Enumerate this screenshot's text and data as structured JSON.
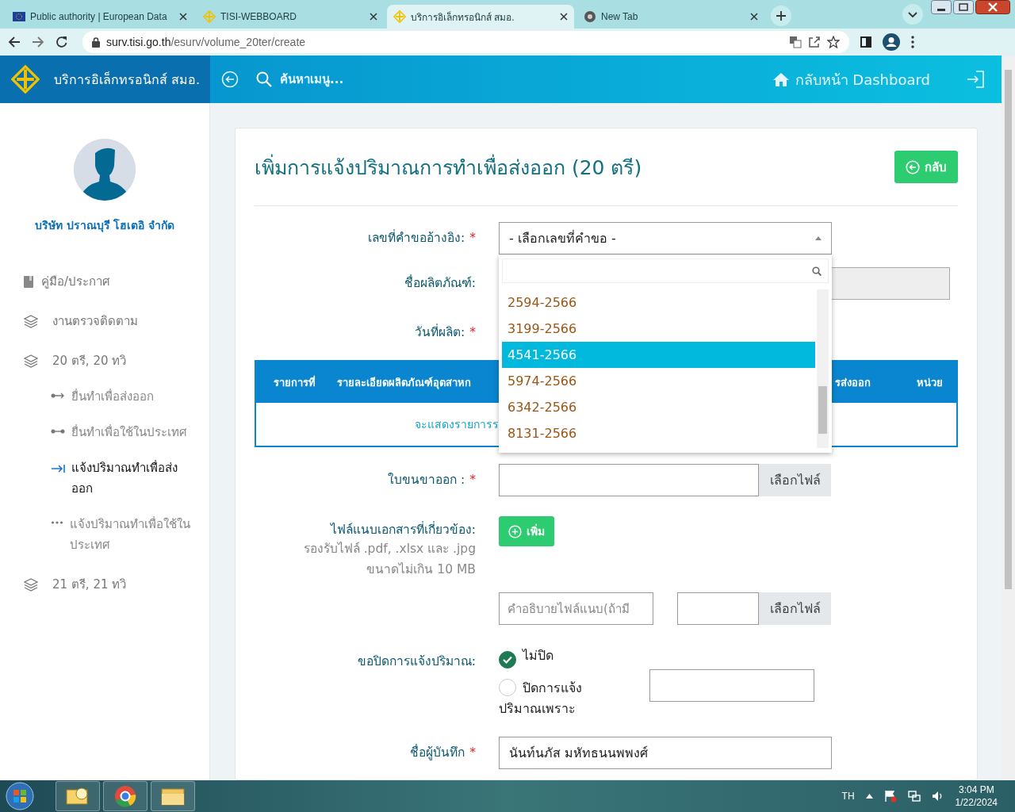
{
  "browser": {
    "tabs": [
      {
        "title": "Public authority | European Data",
        "selected": false
      },
      {
        "title": "TISI-WEBBOARD",
        "selected": false
      },
      {
        "title": "บริการอิเล็กทรอนิกส์ สมอ.",
        "selected": true
      },
      {
        "title": "New Tab",
        "selected": false
      }
    ],
    "url": {
      "host": "surv.tisi.go.th",
      "path": "/esurv/volume_20ter/create"
    }
  },
  "header": {
    "brand": "บริการอิเล็กทรอนิกส์ สมอ.",
    "search_label": "ค้นหาเมนู...",
    "dashboard_link": "กลับหน้า Dashboard"
  },
  "sidebar": {
    "company": "บริษัท ปราณบุรี โฮเตอิ จำกัด",
    "items": [
      {
        "label": "คู่มือ/ประกาศ",
        "kind": "book",
        "selected": false
      },
      {
        "label": "งานตรวจติดตาม",
        "kind": "layers",
        "selected": false
      },
      {
        "label": "20 ตรี, 20 ทวิ",
        "kind": "layers",
        "selected": false,
        "children": [
          {
            "label": "ยื่นทำเพื่อส่งออก",
            "kind": "dot-arrow",
            "selected": false
          },
          {
            "label": "ยื่นทำเพื่อใช้ในประเทศ",
            "kind": "dot-line",
            "selected": false
          },
          {
            "label": "แจ้งปริมาณทำเพื่อส่งออก",
            "kind": "arrow-bar",
            "selected": true
          },
          {
            "label": "แจ้งปริมาณทำเพื่อใช้ในประเทศ",
            "kind": "dots",
            "selected": false
          }
        ]
      },
      {
        "label": "21 ตรี, 21 ทวิ",
        "kind": "layers",
        "selected": false
      }
    ]
  },
  "form": {
    "title": "เพิ่มการแจ้งปริมาณการทำเพื่อส่งออก (20 ตรี)",
    "back_button": "กลับ",
    "reference": {
      "label": "เลขที่คำขออ้างอิง:",
      "required_mark": "*",
      "value": "- เลือกเลขที่คำขอ -",
      "expanded": true,
      "options": [
        {
          "label": "2594-2566",
          "selected": false
        },
        {
          "label": "3199-2566",
          "selected": false
        },
        {
          "label": "4541-2566",
          "selected": true
        },
        {
          "label": "5974-2566",
          "selected": false
        },
        {
          "label": "6342-2566",
          "selected": false
        },
        {
          "label": "8131-2566",
          "selected": false
        }
      ]
    },
    "product": {
      "label": "ชื่อผลิตภัณฑ์:"
    },
    "date": {
      "label": "วันที่ผลิต:",
      "required_mark": "*"
    },
    "table": {
      "columns": [
        "รายการที่",
        "รายละเอียดผลิตภัณฑ์อุตสาหก",
        "รส่งออก",
        "หน่วย"
      ],
      "empty_message": "จะแสดงรายการร"
    },
    "waybill": {
      "label": "ใบขนขาออก :",
      "required_mark": "*",
      "button": "เลือกไฟล์"
    },
    "attachments": {
      "label": "ไฟล์แนบเอกสารที่เกี่ยวข้อง:",
      "hint_lines": [
        "รองรับไฟล์ .pdf, .xlsx และ .jpg",
        "ขนาดไม่เกิน 10 MB"
      ],
      "add_button": "เพิ่ม",
      "description_placeholder": "คำอธิบายไฟล์แนบ(ถ้ามี",
      "button": "เลือกไฟล์"
    },
    "close_option": {
      "label": "ขอปิดการแจ้งปริมาณ:",
      "options": [
        {
          "label": "ไม่ปิด",
          "selected": true
        },
        {
          "label": "ปิดการแจ้งปริมาณเพราะ",
          "selected": false
        }
      ]
    },
    "recorder": {
      "label": "ชื่อผู้บันทึก",
      "required_mark": "*",
      "value": "นันท์นภัส มหัทธนนพพงศ์"
    }
  },
  "taskbar": {
    "language": "TH",
    "time": "3:04 PM",
    "date": "1/22/2024"
  }
}
